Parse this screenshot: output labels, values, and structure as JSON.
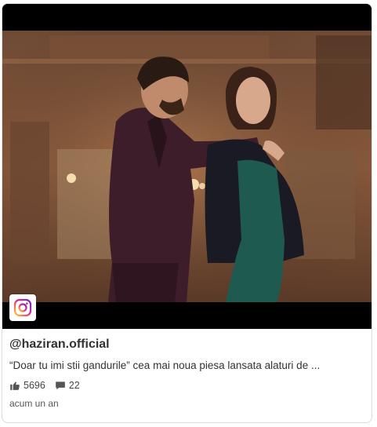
{
  "post": {
    "username": "@haziran.official",
    "caption": "“Doar tu imi stii gandurile” cea mai noua piesa lansata alaturi de ...",
    "likes": "5696",
    "comments": "22",
    "time": "acum un an"
  },
  "icons": {
    "badge": "instagram-icon",
    "likes": "thumbs-up-icon",
    "comments": "comment-icon"
  },
  "colors": {
    "text": "#333333",
    "border": "#dcdcdc",
    "instagram_gradient": [
      "#f9ce34",
      "#ee2a7b",
      "#6228d7"
    ]
  }
}
